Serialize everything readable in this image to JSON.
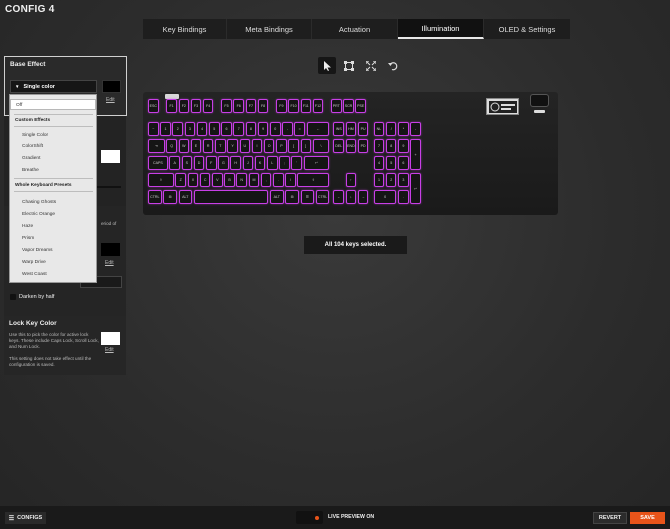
{
  "window": {
    "title": "CONFIG 4"
  },
  "tabs": [
    {
      "label": "Key Bindings",
      "active": false
    },
    {
      "label": "Meta Bindings",
      "active": false
    },
    {
      "label": "Actuation",
      "active": false
    },
    {
      "label": "Illumination",
      "active": true
    },
    {
      "label": "OLED & Settings",
      "active": false
    }
  ],
  "tools": [
    {
      "icon": "pointer-icon",
      "active": true
    },
    {
      "icon": "marquee-select-icon",
      "active": false
    },
    {
      "icon": "expand-icon",
      "active": false
    },
    {
      "icon": "undo-icon",
      "active": false
    }
  ],
  "base_effect": {
    "title": "Base Effect",
    "selected": "Single color",
    "edit_label": "Edit",
    "color": "#000000"
  },
  "dropdown": {
    "off": "Off",
    "custom_header": "Custom Effects",
    "custom": [
      "Single Color",
      "ColorShift",
      "Gradient",
      "Breathe"
    ],
    "presets_header": "Whole Keyboard Presets",
    "presets": [
      "Chasing Ghosts",
      "Electric Orange",
      "Haze",
      "Prism",
      "Vapor Dreams",
      "Warp Drive",
      "West Coast"
    ]
  },
  "hidden_panel": {
    "text_fragment": "eriod of",
    "edit_label_1": "Edit",
    "edit_label_2": "Edit",
    "color_white": "#ffffff",
    "color_black": "#000000"
  },
  "darken": {
    "label": "Darken by half"
  },
  "lock_key": {
    "title": "Lock Key Color",
    "desc_1": "Use this to pick the color for active lock keys. These include Caps Lock, Scroll Lock, and Num Lock.",
    "desc_2": "This setting does not take effect until the configuration is saved.",
    "edit_label": "Edit",
    "color": "#ffffff"
  },
  "keyboard": {
    "accent": "#c83fe6",
    "row0": [
      "ESC",
      "F1",
      "F2",
      "F3",
      "F4",
      "F5",
      "F6",
      "F7",
      "F8",
      "F9",
      "F10",
      "F11",
      "F12",
      "PRT",
      "SCR",
      "PSE"
    ],
    "row1": [
      "~",
      "1",
      "2",
      "3",
      "4",
      "5",
      "6",
      "7",
      "8",
      "9",
      "0",
      "-",
      "=",
      "←",
      "INS",
      "HM",
      "PU",
      "NL",
      "/",
      "*",
      "-"
    ],
    "row2": [
      "⇥",
      "Q",
      "W",
      "E",
      "R",
      "T",
      "Y",
      "U",
      "I",
      "O",
      "P",
      "[",
      "]",
      "\\",
      "DEL",
      "END",
      "PD",
      "7",
      "8",
      "9",
      "+"
    ],
    "row3": [
      "CAPS",
      "A",
      "S",
      "D",
      "F",
      "G",
      "H",
      "J",
      "K",
      "L",
      ";",
      "'",
      "↵",
      "4",
      "5",
      "6"
    ],
    "row4": [
      "⇧",
      "Z",
      "X",
      "C",
      "V",
      "B",
      "N",
      "M",
      ",",
      ".",
      "/",
      "⇧",
      "↑",
      "1",
      "2",
      "3",
      "↵"
    ],
    "row5": [
      "CTRL",
      "⊞",
      "ALT",
      "",
      "ALT",
      "⊞",
      "☰",
      "CTRL",
      "←",
      "↓",
      "→",
      "0",
      "."
    ]
  },
  "status": "All 104 keys selected.",
  "footer": {
    "configs_label": "CONFIGS",
    "live_preview": "LIVE PREVIEW ON",
    "revert": "REVERT",
    "save": "SAVE",
    "save_color": "#e8541a"
  }
}
